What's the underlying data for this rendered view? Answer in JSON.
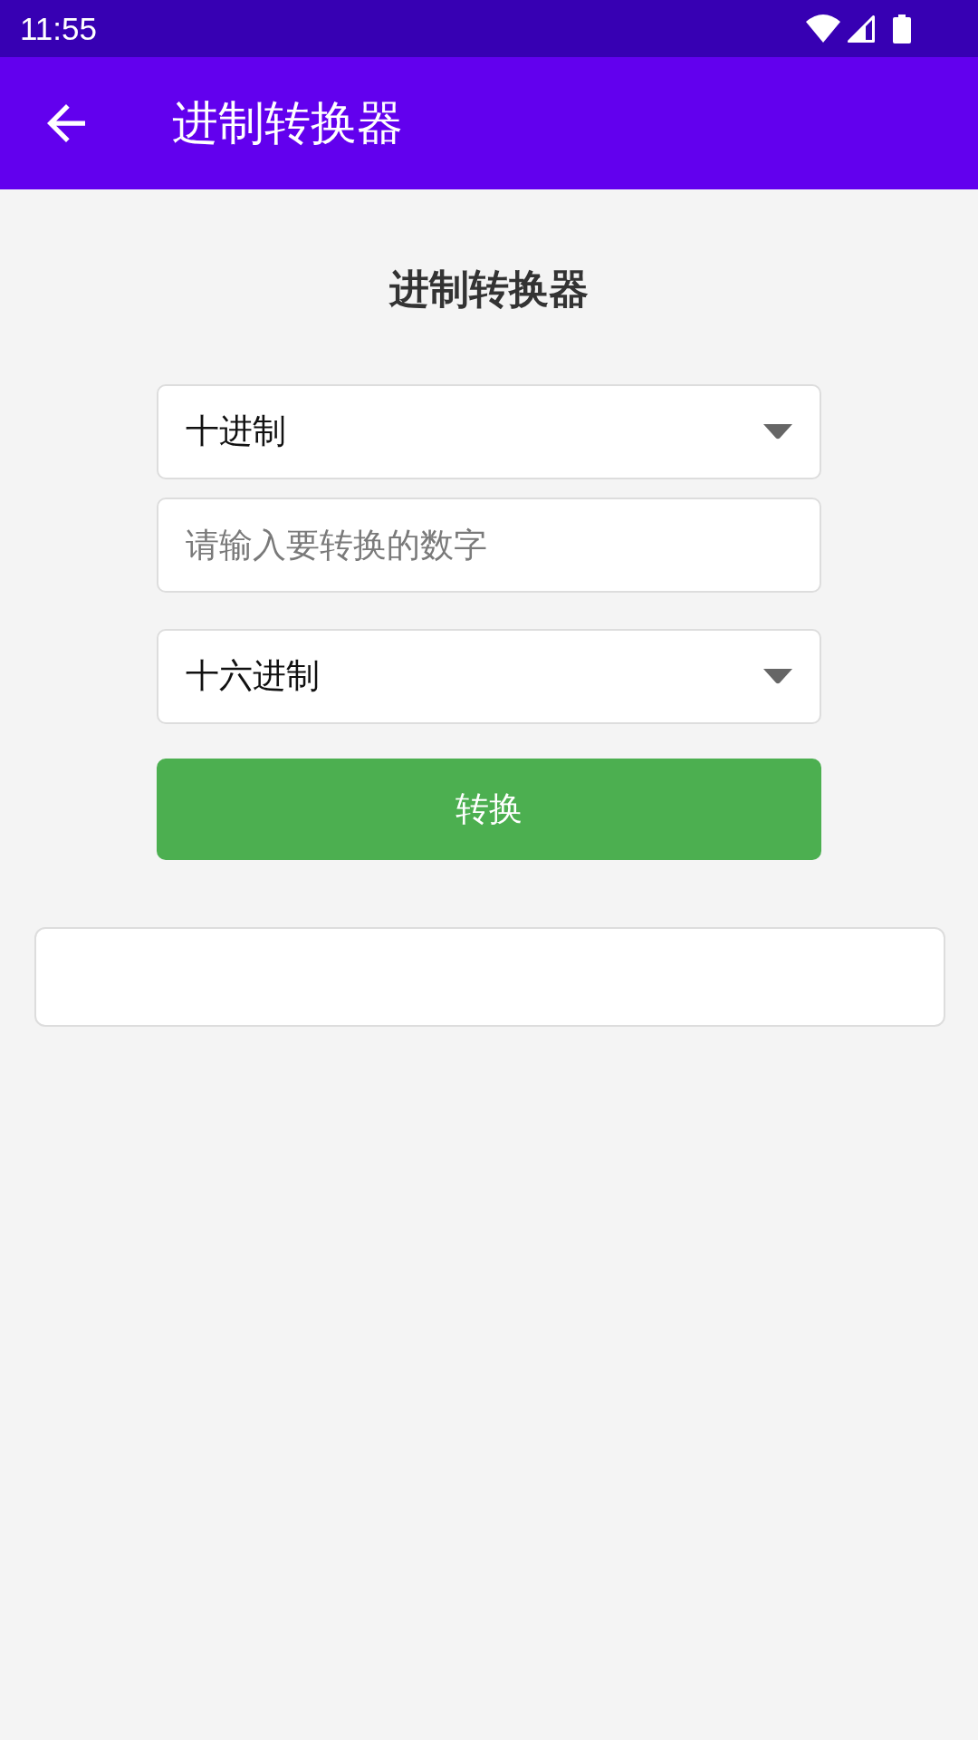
{
  "status_bar": {
    "time": "11:55"
  },
  "app_bar": {
    "title": "进制转换器"
  },
  "heading": "进制转换器",
  "from_select": {
    "value": "十进制"
  },
  "number_input": {
    "placeholder": "请输入要转换的数字"
  },
  "to_select": {
    "value": "十六进制"
  },
  "convert_button": {
    "label": "转换"
  }
}
